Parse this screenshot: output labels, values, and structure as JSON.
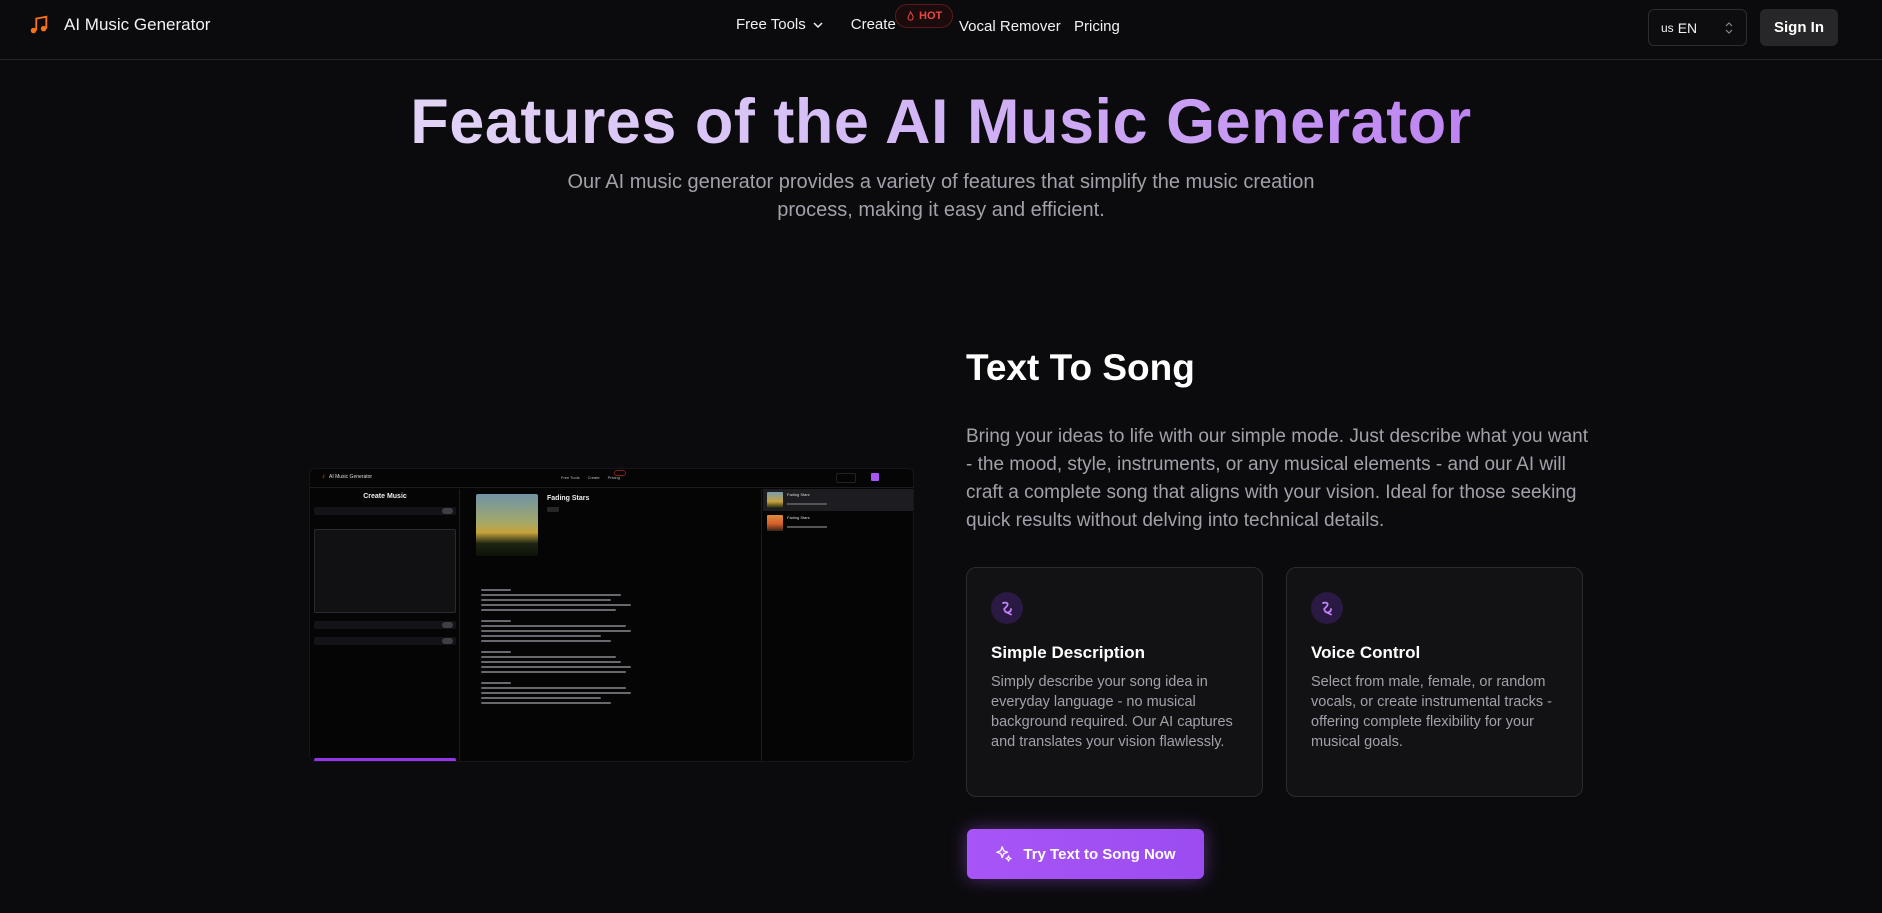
{
  "nav": {
    "brand": "AI Music Generator",
    "brand_icon": "music-note-icon",
    "free_tools": "Free Tools",
    "create": "Create",
    "hot_badge": "HOT",
    "vocal_remover": "Vocal Remover",
    "pricing": "Pricing",
    "language": {
      "flag": "us",
      "code": "EN"
    },
    "sign_in": "Sign In"
  },
  "hero": {
    "title": "Features of the AI Music Generator",
    "subtitle": "Our AI music generator provides a variety of features that simplify the music creation process, making it easy and efficient."
  },
  "mock": {
    "brand": "AI Music Generator",
    "nav_links": [
      "Free Tools",
      "Create",
      "Pricing"
    ],
    "panel_title": "Create Music",
    "song_title": "Fading Stars"
  },
  "feature": {
    "title": "Text To Song",
    "description": "Bring your ideas to life with our simple mode. Just describe what you want - the mood, style, instruments, or any musical elements - and our AI will craft a complete song that aligns with your vision. Ideal for those seeking quick results without delving into technical details.",
    "cards": [
      {
        "icon": "squiggle-icon",
        "title": "Simple Description",
        "description": "Simply describe your song idea in everyday language - no musical background required. Our AI captures and translates your vision flawlessly."
      },
      {
        "icon": "squiggle-icon",
        "title": "Voice Control",
        "description": "Select from male, female, or random vocals, or create instrumental tracks - offering complete flexibility for your musical goals."
      }
    ],
    "cta": "Try Text to Song Now",
    "cta_icon": "sparkles-icon"
  },
  "colors": {
    "background": "#0b0b0d",
    "accent": "#a855f7",
    "hot": "#ef4444"
  }
}
